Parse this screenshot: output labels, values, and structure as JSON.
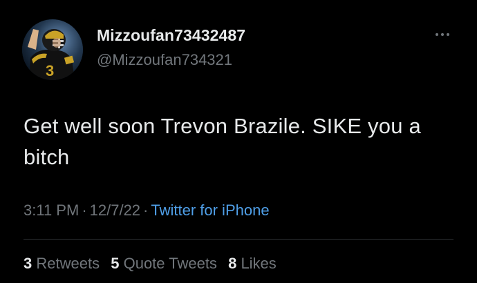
{
  "author": {
    "display_name": "Mizzoufan73432487",
    "handle": "@Mizzoufan734321"
  },
  "icons": {
    "avatar": "football-player-avatar",
    "more": "more-options-icon"
  },
  "tweet": {
    "text": "Get well soon Trevon Brazile. SIKE you a bitch",
    "time": "3:11 PM",
    "separator": "·",
    "date": "12/7/22",
    "source": "Twitter for iPhone"
  },
  "stats": {
    "retweets": {
      "count": "3",
      "label": "Retweets"
    },
    "quote_tweets": {
      "count": "5",
      "label": "Quote Tweets"
    },
    "likes": {
      "count": "8",
      "label": "Likes"
    }
  },
  "colors": {
    "background": "#000000",
    "primary_text": "#e7e9ea",
    "secondary_text": "#71767b",
    "link": "#4f9fe8",
    "divider": "#2f3336"
  }
}
